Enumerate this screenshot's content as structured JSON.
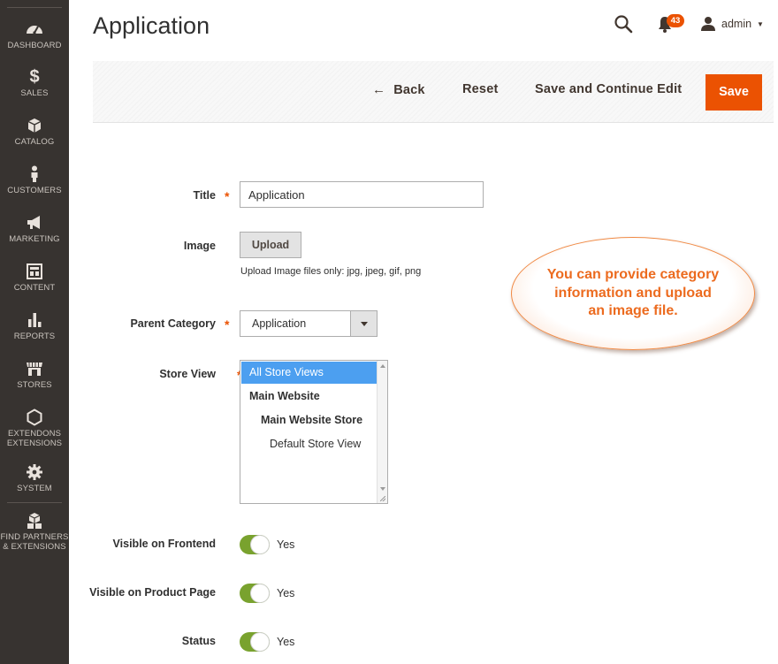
{
  "sidebar": {
    "items": [
      {
        "icon": "dashboard-icon",
        "label": "DASHBOARD"
      },
      {
        "icon": "dollar-icon",
        "label": "SALES"
      },
      {
        "icon": "cube-icon",
        "label": "CATALOG"
      },
      {
        "icon": "person-icon",
        "label": "CUSTOMERS"
      },
      {
        "icon": "megaphone-icon",
        "label": "MARKETING"
      },
      {
        "icon": "content-icon",
        "label": "CONTENT"
      },
      {
        "icon": "bar-chart-icon",
        "label": "REPORTS"
      },
      {
        "icon": "store-icon",
        "label": "STORES"
      },
      {
        "icon": "hexagon-icon",
        "label": "EXTENDONS",
        "label2": "EXTENSIONS"
      },
      {
        "icon": "gear-icon",
        "label": "SYSTEM"
      },
      {
        "icon": "boxes-icon",
        "label": "FIND PARTNERS",
        "label2": "& EXTENSIONS"
      }
    ]
  },
  "header": {
    "title": "Application",
    "notification_count": "43",
    "user": "admin"
  },
  "actions": {
    "back": "Back",
    "reset": "Reset",
    "save_continue": "Save and Continue Edit",
    "save": "Save"
  },
  "form": {
    "title_label": "Title",
    "title_value": "Application",
    "image_label": "Image",
    "upload_label": "Upload",
    "upload_note": "Upload Image files only: jpg, jpeg, gif, png",
    "parent_label": "Parent Category",
    "parent_value": "Application",
    "store_label": "Store View",
    "store_options": [
      {
        "label": "All Store Views",
        "selected": true
      },
      {
        "label": "Main Website",
        "bold": true
      },
      {
        "label": "Main Website Store",
        "bold": true
      },
      {
        "label": "Default Store View"
      }
    ],
    "visible_frontend_label": "Visible on Frontend",
    "visible_frontend_value": "Yes",
    "visible_product_label": "Visible on Product Page",
    "visible_product_value": "Yes",
    "status_label": "Status",
    "status_value": "Yes"
  },
  "callout": {
    "text": "You can provide category information and upload an image file."
  },
  "colors": {
    "sidebar": "#373330",
    "accent": "#eb5202",
    "toggle_on": "#79a22e",
    "selected_option": "#4c9ff0",
    "callout_text": "#ec6b1f"
  }
}
